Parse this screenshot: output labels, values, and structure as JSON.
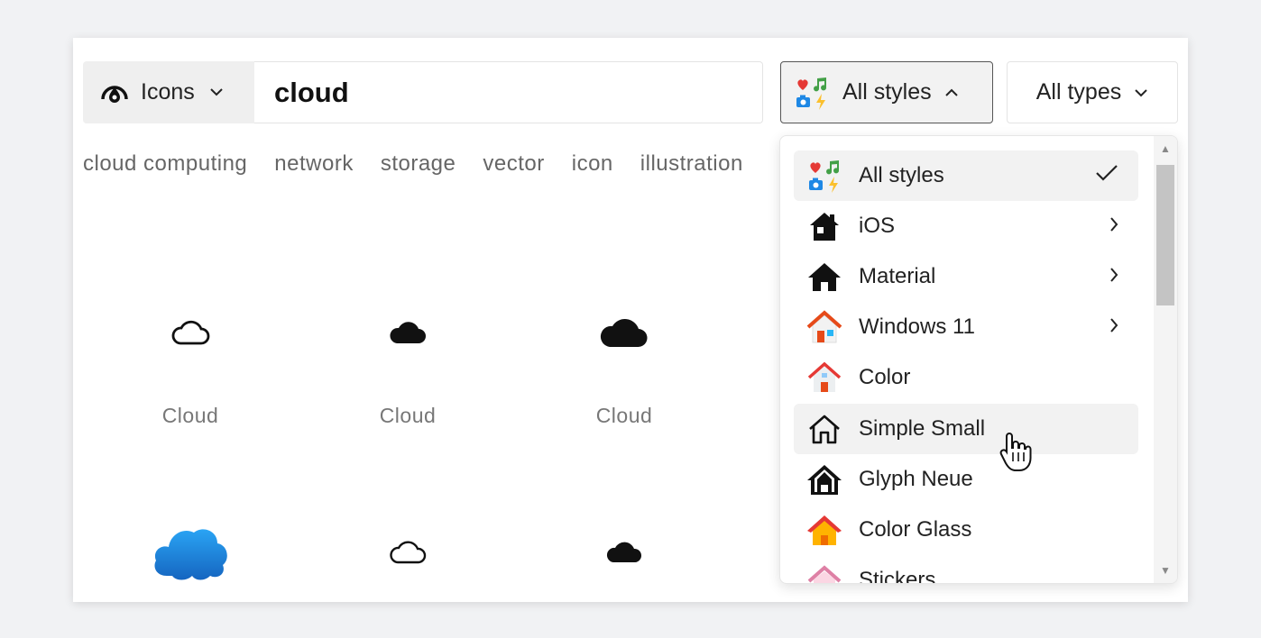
{
  "search": {
    "type_label": "Icons",
    "query": "cloud",
    "styles_label": "All styles",
    "types_label": "All types"
  },
  "tags": [
    "cloud computing",
    "network",
    "storage",
    "vector",
    "icon",
    "illustration"
  ],
  "results": [
    {
      "label": "Cloud",
      "icon": "cloud-outline-icon"
    },
    {
      "label": "Cloud",
      "icon": "cloud-filled-icon"
    },
    {
      "label": "Cloud",
      "icon": "cloud-filled-large-icon"
    },
    {
      "label": "",
      "icon": "cloud-color-icon"
    },
    {
      "label": "",
      "icon": "cloud-outline-small-icon"
    },
    {
      "label": "",
      "icon": "cloud-filled-small-icon"
    }
  ],
  "styles_menu": {
    "items": [
      {
        "label": "All styles",
        "icon": "all-styles-icon",
        "trail": "check",
        "selected": true
      },
      {
        "label": "iOS",
        "icon": "home-ios-icon",
        "trail": "chevron"
      },
      {
        "label": "Material",
        "icon": "home-material-icon",
        "trail": "chevron"
      },
      {
        "label": "Windows 11",
        "icon": "home-windows-icon",
        "trail": "chevron"
      },
      {
        "label": "Color",
        "icon": "home-color-icon"
      },
      {
        "label": "Simple Small",
        "icon": "home-simple-small-icon",
        "hovered": true
      },
      {
        "label": "Glyph Neue",
        "icon": "home-glyph-icon"
      },
      {
        "label": "Color Glass",
        "icon": "home-color-glass-icon"
      },
      {
        "label": "Stickers",
        "icon": "home-stickers-icon"
      }
    ]
  },
  "colors": {
    "accent_heart": "#e53935",
    "accent_music": "#43a047",
    "accent_camera": "#1e88e5",
    "accent_bolt": "#fbc02d"
  }
}
